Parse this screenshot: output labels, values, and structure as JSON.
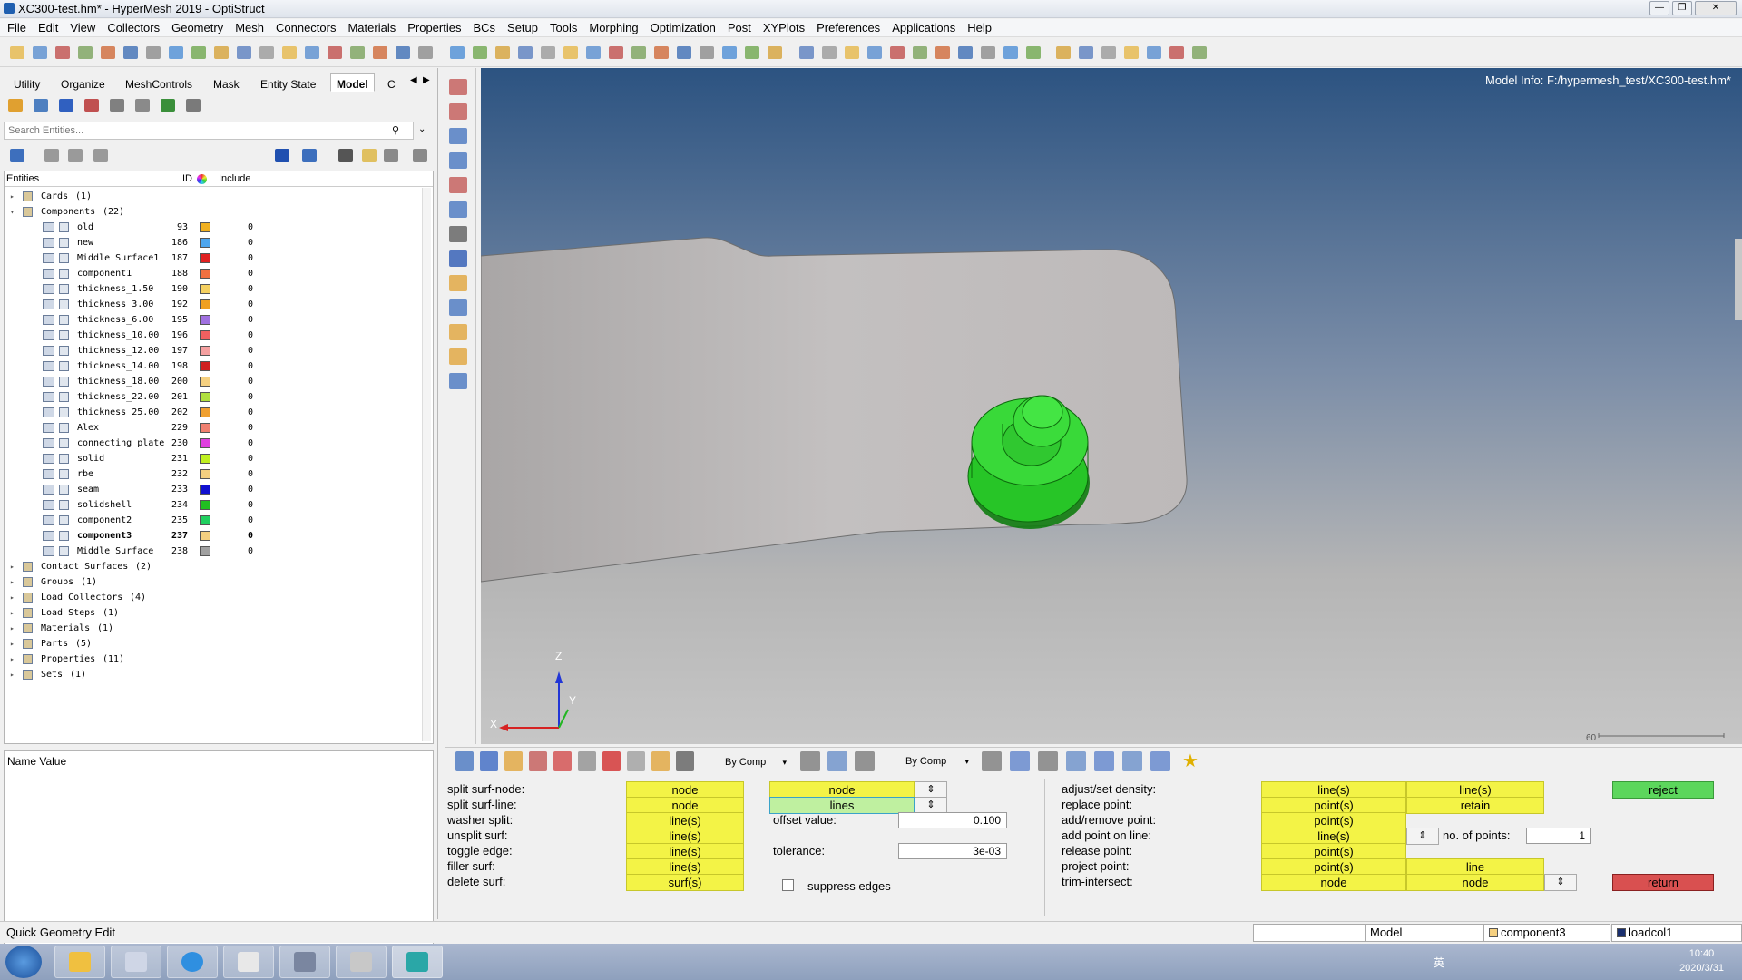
{
  "app": {
    "title": "XC300-test.hm* - HyperMesh 2019 - OptiStruct"
  },
  "menu": [
    "File",
    "Edit",
    "View",
    "Collectors",
    "Geometry",
    "Mesh",
    "Connectors",
    "Materials",
    "Properties",
    "BCs",
    "Setup",
    "Tools",
    "Morphing",
    "Optimization",
    "Post",
    "XYPlots",
    "Preferences",
    "Applications",
    "Help"
  ],
  "browser": {
    "tabs": [
      "Utility",
      "Organize",
      "MeshControls",
      "Mask",
      "Entity State",
      "Model",
      "C"
    ],
    "active_tab": "Model",
    "search_placeholder": "Search Entities...",
    "columns": {
      "entities": "Entities",
      "id": "ID",
      "include": "Include"
    },
    "groups_top": [
      {
        "label": "Cards",
        "count": "(1)"
      },
      {
        "label": "Components",
        "count": "(22)"
      }
    ],
    "components": [
      {
        "name": "old",
        "id": "93",
        "color": "#f0b020",
        "include": "0"
      },
      {
        "name": "new",
        "id": "186",
        "color": "#4ea6ee",
        "include": "0"
      },
      {
        "name": "Middle Surface1",
        "id": "187",
        "color": "#e02020",
        "include": "0"
      },
      {
        "name": "component1",
        "id": "188",
        "color": "#f07040",
        "include": "0"
      },
      {
        "name": "thickness_1.50",
        "id": "190",
        "color": "#f5d060",
        "include": "0"
      },
      {
        "name": "thickness_3.00",
        "id": "192",
        "color": "#f0a020",
        "include": "0"
      },
      {
        "name": "thickness_6.00",
        "id": "195",
        "color": "#a070e0",
        "include": "0"
      },
      {
        "name": "thickness_10.00",
        "id": "196",
        "color": "#f06060",
        "include": "0"
      },
      {
        "name": "thickness_12.00",
        "id": "197",
        "color": "#f5a0a0",
        "include": "0"
      },
      {
        "name": "thickness_14.00",
        "id": "198",
        "color": "#d02020",
        "include": "0"
      },
      {
        "name": "thickness_18.00",
        "id": "200",
        "color": "#f5d080",
        "include": "0"
      },
      {
        "name": "thickness_22.00",
        "id": "201",
        "color": "#b0e040",
        "include": "0"
      },
      {
        "name": "thickness_25.00",
        "id": "202",
        "color": "#f0a030",
        "include": "0"
      },
      {
        "name": "Alex",
        "id": "229",
        "color": "#f08070",
        "include": "0"
      },
      {
        "name": "connecting plate",
        "id": "230",
        "color": "#e040e0",
        "include": "0"
      },
      {
        "name": "solid",
        "id": "231",
        "color": "#c0f020",
        "include": "0"
      },
      {
        "name": "rbe",
        "id": "232",
        "color": "#f5d080",
        "include": "0"
      },
      {
        "name": "seam",
        "id": "233",
        "color": "#1010d0",
        "include": "0"
      },
      {
        "name": "solidshell",
        "id": "234",
        "color": "#20c020",
        "include": "0"
      },
      {
        "name": "component2",
        "id": "235",
        "color": "#20d060",
        "include": "0"
      },
      {
        "name": "component3",
        "id": "237",
        "color": "#f5d080",
        "include": "0",
        "bold": true
      },
      {
        "name": "Middle Surface",
        "id": "238",
        "color": "#a0a0a0",
        "include": "0"
      }
    ],
    "groups_bottom": [
      {
        "label": "Contact Surfaces",
        "count": "(2)"
      },
      {
        "label": "Groups",
        "count": "(1)"
      },
      {
        "label": "Load Collectors",
        "count": "(4)"
      },
      {
        "label": "Load Steps",
        "count": "(1)"
      },
      {
        "label": "Materials",
        "count": "(1)"
      },
      {
        "label": "Parts",
        "count": "(5)"
      },
      {
        "label": "Properties",
        "count": "(11)"
      },
      {
        "label": "Sets",
        "count": "(1)"
      }
    ],
    "props_header": "Name Value"
  },
  "viewport": {
    "model_info": "Model Info: F:/hypermesh_test/XC300-test.hm*",
    "axis": {
      "x": "X",
      "y": "Y",
      "z": "Z"
    },
    "scale": "60"
  },
  "vtoolbar": {
    "by_comp_1": "By Comp",
    "by_comp_2": "By Comp"
  },
  "panel": {
    "rows": [
      {
        "label": "split surf-node:",
        "b1": "node",
        "b2": "node"
      },
      {
        "label": "split surf-line:",
        "b1": "node",
        "b2": "lines"
      },
      {
        "label": "washer split:",
        "b1": "line(s)"
      },
      {
        "label": "unsplit surf:",
        "b1": "line(s)"
      },
      {
        "label": "toggle edge:",
        "b1": "line(s)"
      },
      {
        "label": "filler surf:",
        "b1": "line(s)"
      },
      {
        "label": "delete surf:",
        "b1": "surf(s)"
      }
    ],
    "offset_label": "offset value:",
    "offset_value": "0.100",
    "tolerance_label": "tolerance:",
    "tolerance_value": "3e-03",
    "suppress_label": "suppress edges",
    "right_rows": [
      {
        "label": "adjust/set density:",
        "b1": "line(s)",
        "b2": "line(s)"
      },
      {
        "label": "replace point:",
        "b1": "point(s)",
        "b2": "retain"
      },
      {
        "label": "add/remove point:",
        "b1": "point(s)"
      },
      {
        "label": "add point on line:",
        "b1": "line(s)"
      },
      {
        "label": "release point:",
        "b1": "point(s)"
      },
      {
        "label": "project point:",
        "b1": "point(s)",
        "b2": "line"
      },
      {
        "label": "trim-intersect:",
        "b1": "node",
        "b2": "node"
      }
    ],
    "points_label": "no. of points:",
    "points_value": "1",
    "reject": "reject",
    "return": "return",
    "colors": {
      "yellow": "#f3f346",
      "reject": "#5cd65c",
      "return": "#d95050"
    }
  },
  "status": {
    "text": "Quick Geometry Edit",
    "model": "Model",
    "component": "component3",
    "loadcol": "loadcol1"
  },
  "taskbar": {
    "time": "10:40",
    "date": "2020/3/31",
    "ime": "英"
  }
}
